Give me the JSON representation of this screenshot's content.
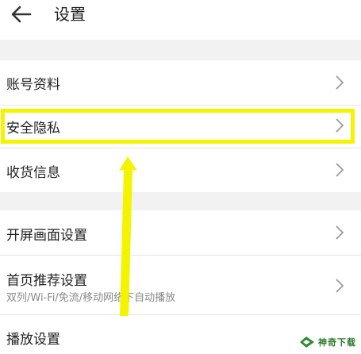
{
  "header": {
    "title": "设置",
    "back_icon": "arrow-left-icon"
  },
  "settings_groups": [
    {
      "items": [
        {
          "label": "账号资料"
        },
        {
          "label": "安全隐私",
          "highlighted": true
        },
        {
          "label": "收货信息"
        }
      ]
    },
    {
      "items": [
        {
          "label": "开屏画面设置"
        },
        {
          "label": "首页推荐设置",
          "subtitle": "双列/Wi-Fi/免流/移动网络下自动播放"
        },
        {
          "label": "播放设置"
        }
      ]
    }
  ],
  "annotation": {
    "highlight_color": "#f4f400",
    "target": "安全隐私"
  },
  "watermark": {
    "text": "神奇下载"
  },
  "colors": {
    "background": "#f2f2f2",
    "surface": "#ffffff",
    "text": "#222222",
    "subtext": "#888888",
    "chevron": "#9a9a9a"
  }
}
